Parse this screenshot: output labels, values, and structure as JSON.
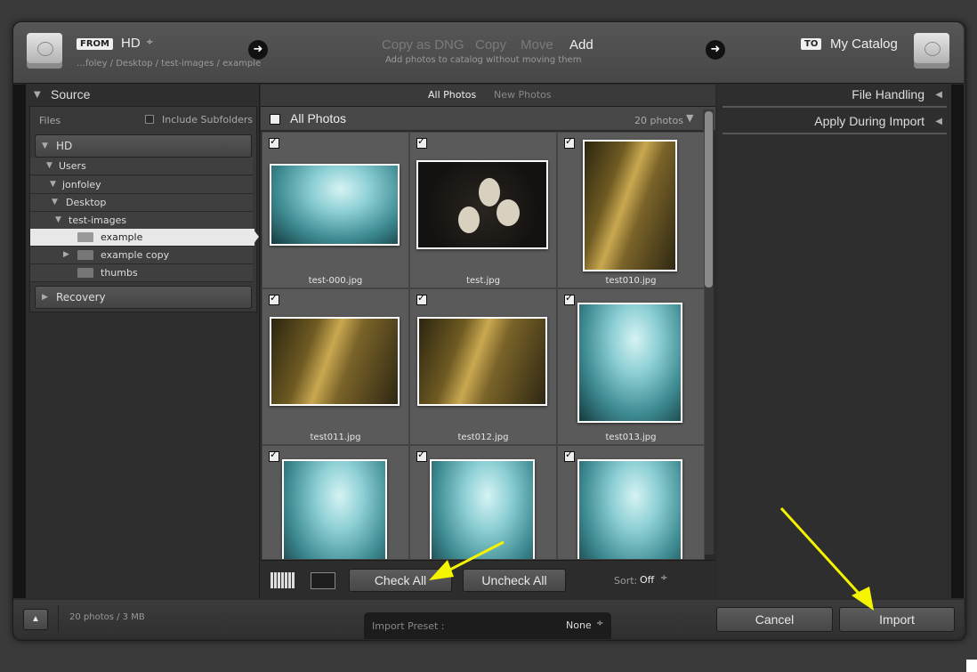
{
  "header": {
    "from_badge": "FROM",
    "source_drive": "HD",
    "source_path": "…foley / Desktop / test-images / example",
    "modes": [
      "Copy as DNG",
      "Copy",
      "Move",
      "Add"
    ],
    "active_mode": "Add",
    "mode_description": "Add photos to catalog without moving them",
    "to_badge": "TO",
    "destination": "My Catalog"
  },
  "source_panel": {
    "title": "Source",
    "files_label": "Files",
    "include_subfolders_label": "Include Subfolders",
    "volume_hd": "HD",
    "tree": [
      "Users",
      "jonfoley",
      "Desktop",
      "test-images"
    ],
    "folders": [
      "example",
      "example copy",
      "thumbs"
    ],
    "selected_folder": "example",
    "volume_recovery": "Recovery"
  },
  "grid": {
    "filter_tabs": [
      "All Photos",
      "New Photos"
    ],
    "active_filter": "All Photos",
    "section_title": "All Photos",
    "photo_count": "20 photos",
    "photos": [
      {
        "name": "test-000.jpg",
        "style": "aqua-landscape"
      },
      {
        "name": "test.jpg",
        "style": "eggs"
      },
      {
        "name": "test010.jpg",
        "style": "forest-portrait"
      },
      {
        "name": "test011.jpg",
        "style": "forest-landscape"
      },
      {
        "name": "test012.jpg",
        "style": "forest-landscape"
      },
      {
        "name": "test013.jpg",
        "style": "aqua-portrait"
      },
      {
        "name": "",
        "style": "aqua-portrait"
      },
      {
        "name": "",
        "style": "aqua-portrait"
      },
      {
        "name": "",
        "style": "aqua-portrait"
      }
    ],
    "check_all_label": "Check All",
    "uncheck_all_label": "Uncheck All",
    "sort_label": "Sort:",
    "sort_value": "Off"
  },
  "right_panel": {
    "file_handling": "File Handling",
    "apply_during_import": "Apply During Import"
  },
  "footer": {
    "summary": "20 photos / 3 MB",
    "import_preset_label": "Import Preset :",
    "import_preset_value": "None",
    "cancel_label": "Cancel",
    "import_label": "Import"
  },
  "colors": {
    "annotation_arrow": "#f5f500",
    "panel_bg": "#2e2e2e",
    "thumb_cell_bg": "#5a5a5a"
  }
}
